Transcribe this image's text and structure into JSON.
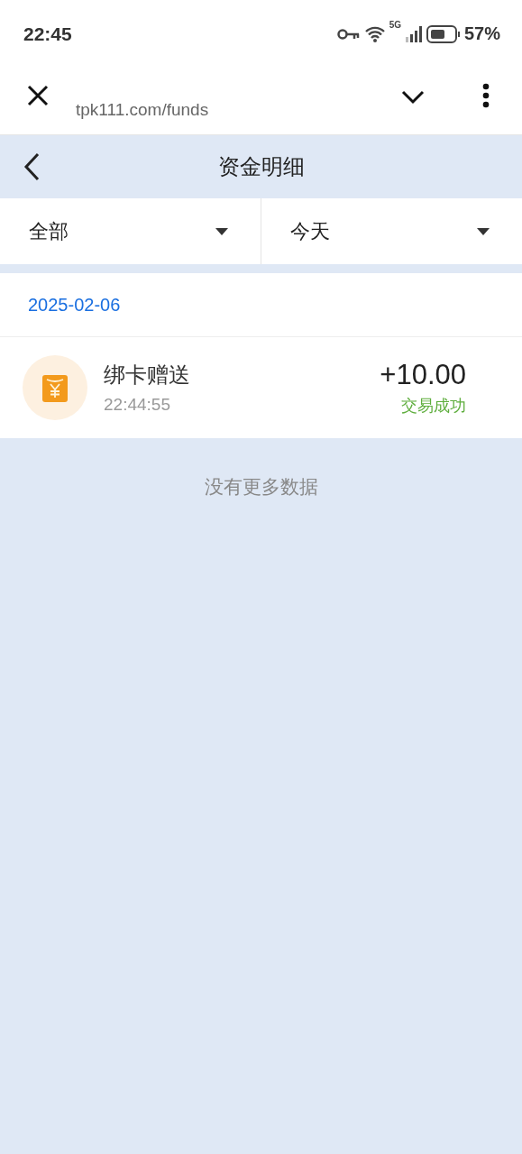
{
  "status_bar": {
    "time": "22:45",
    "network": "5G",
    "battery": "57%"
  },
  "browser": {
    "url": "tpk111.com/funds"
  },
  "header": {
    "title": "资金明细"
  },
  "filters": [
    {
      "label": "全部"
    },
    {
      "label": "今天"
    }
  ],
  "date": "2025-02-06",
  "transactions": [
    {
      "title": "绑卡赠送",
      "time": "22:44:55",
      "amount": "+10.00",
      "status": "交易成功"
    }
  ],
  "footer": "没有更多数据"
}
